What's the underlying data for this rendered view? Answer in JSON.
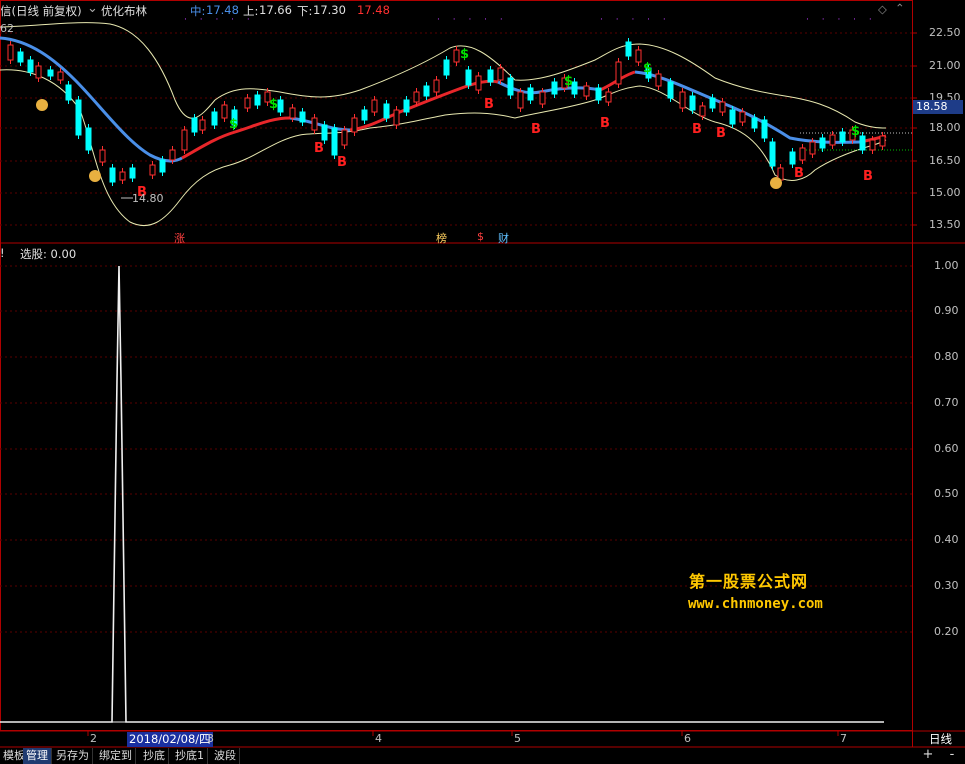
{
  "header": {
    "title": "信(日线 前复权)",
    "indicator_name": "优化布林",
    "mid_label": "中:",
    "mid_value": "17.48",
    "upper_label": "上:",
    "upper_value": "17.66",
    "lower_label": "下:",
    "lower_value": "17.30",
    "extra_value": "17.48",
    "high_label": "62",
    "low_label": "14.80"
  },
  "price_axis": {
    "labels": [
      "22.50",
      "21.00",
      "19.50",
      "18.00",
      "16.50",
      "15.00",
      "13.50"
    ],
    "current_price": "18.58"
  },
  "signal_labels": {
    "zhang": "涨",
    "bang": "榜",
    "cai": "财",
    "dollar": "$"
  },
  "indicator_panel": {
    "title": "!",
    "label": "选股: 0.00",
    "axis_labels": [
      "1.00",
      "0.90",
      "0.80",
      "0.70",
      "0.60",
      "0.50",
      "0.40",
      "0.30",
      "0.20"
    ]
  },
  "x_axis": {
    "selected_date": "2018/02/08/四",
    "ticks": [
      "2",
      "3",
      "4",
      "5",
      "6",
      "7"
    ]
  },
  "period": "日线",
  "bottom_tabs": [
    "模板",
    "管理",
    "另存为",
    "绑定到",
    "抄底",
    "抄底1",
    "波段"
  ],
  "zoom": {
    "plus": "+",
    "minus": "-"
  },
  "watermark": {
    "line1": "第一股票公式网",
    "line2": "www.chnmoney.com"
  },
  "colors": {
    "up": "#ff3030",
    "down": "#00ffff",
    "mid_line_down": "#4a8fe8",
    "mid_line_up": "#e8262a",
    "band": "#f0f0a0",
    "buy_signal": "#ff2020",
    "dollar_signal": "#00e000",
    "watermark": "#ffc800"
  }
}
